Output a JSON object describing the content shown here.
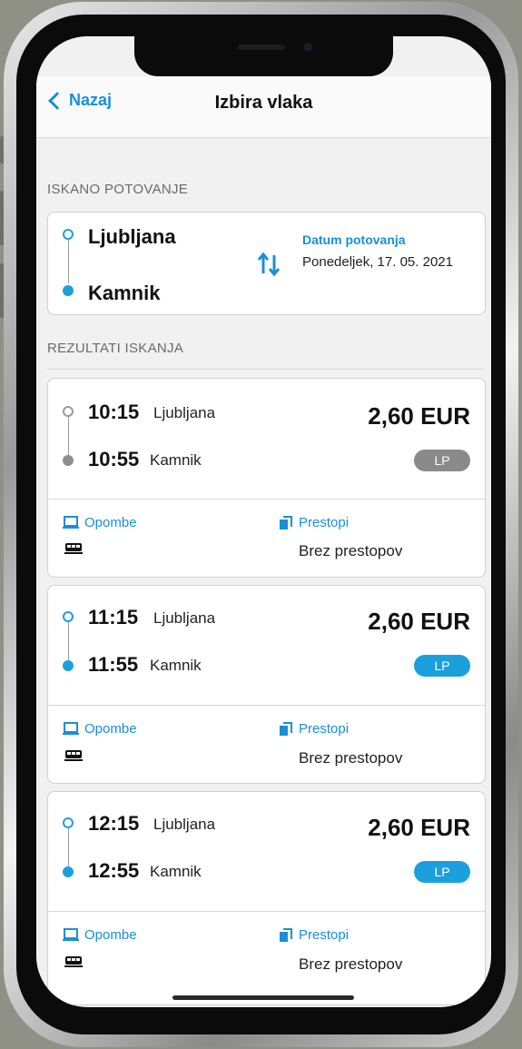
{
  "navbar": {
    "back_label": "Nazaj",
    "title": "Izbira vlaka"
  },
  "search": {
    "section_title": "ISKANO POTOVANJE",
    "from": "Ljubljana",
    "to": "Kamnik",
    "date_label": "Datum potovanja",
    "date_value": "Ponedeljek, 17. 05. 2021"
  },
  "results": {
    "section_title": "REZULTATI ISKANJA",
    "notes_label": "Opombe",
    "transfers_label": "Prestopi",
    "items": [
      {
        "depart_time": "10:15",
        "depart_station": "Ljubljana",
        "arrive_time": "10:55",
        "arrive_station": "Kamnik",
        "price": "2,60 EUR",
        "badge": "LP",
        "badge_state": "inactive",
        "transfers": "Brez prestopov"
      },
      {
        "depart_time": "11:15",
        "depart_station": "Ljubljana",
        "arrive_time": "11:55",
        "arrive_station": "Kamnik",
        "price": "2,60 EUR",
        "badge": "LP",
        "badge_state": "active",
        "transfers": "Brez prestopov"
      },
      {
        "depart_time": "12:15",
        "depart_station": "Ljubljana",
        "arrive_time": "12:55",
        "arrive_station": "Kamnik",
        "price": "2,60 EUR",
        "badge": "LP",
        "badge_state": "active",
        "transfers": "Brez prestopov"
      }
    ]
  },
  "colors": {
    "accent": "#1a8fd6",
    "route_dot": "#1ba0dd",
    "badge_active": "#1ba0dd",
    "badge_inactive": "#8a8a8a"
  }
}
